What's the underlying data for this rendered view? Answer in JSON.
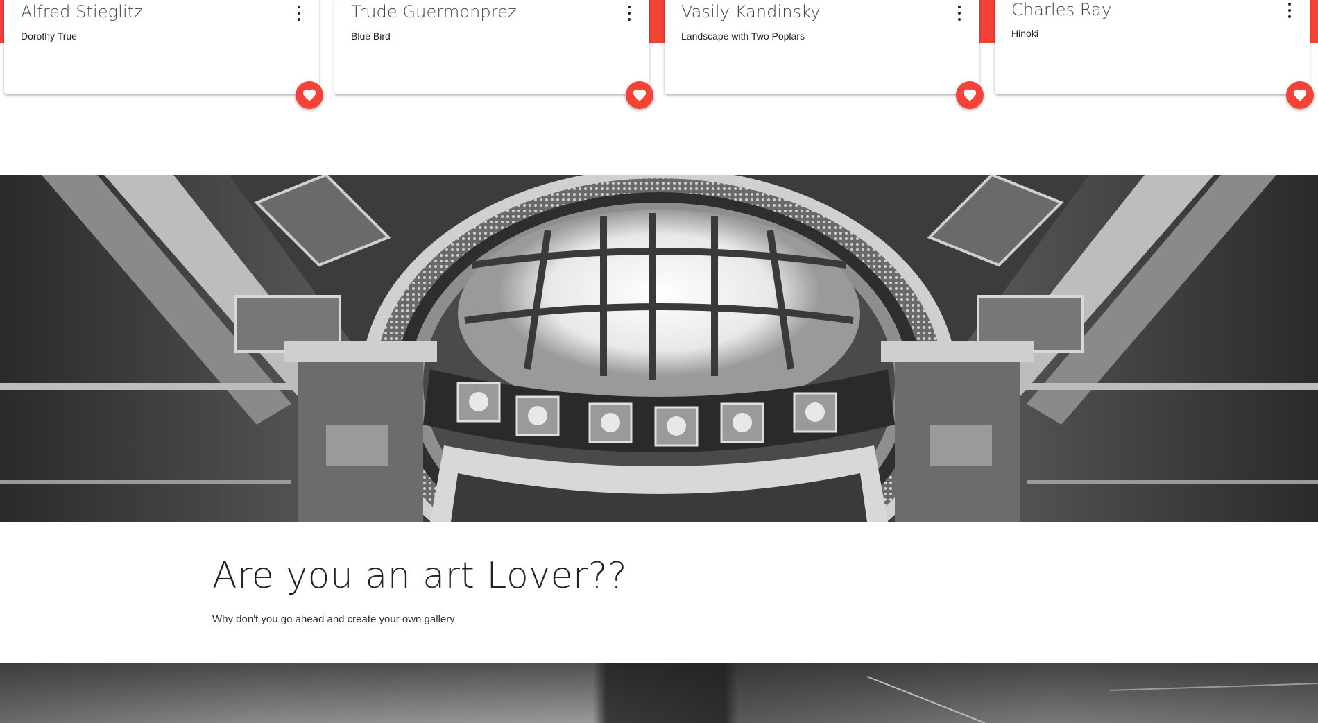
{
  "cards": [
    {
      "artist": "Alfred Stieglitz",
      "artwork": "Dorothy True"
    },
    {
      "artist": "Trude Guermonprez",
      "artwork": "Blue Bird"
    },
    {
      "artist": "Vasily Kandinsky",
      "artwork": "Landscape with Two Poplars"
    },
    {
      "artist": "Charles Ray",
      "artwork": "Hinoki"
    }
  ],
  "cta": {
    "title": "Are you an art Lover??",
    "subtitle": "Why don't you go ahead and create your own gallery"
  },
  "colors": {
    "accent": "#f44336",
    "card_bg": "#ffffff",
    "text": "#222222"
  },
  "icons": {
    "card_menu": "more-vert-icon",
    "card_favorite": "heart-icon"
  }
}
